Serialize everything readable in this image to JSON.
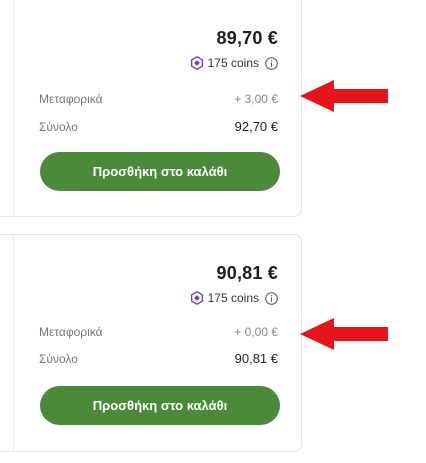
{
  "offers": [
    {
      "price": "89,70 €",
      "coins_text": "175 coins",
      "shipping_label": "Μεταφορικά",
      "shipping_value": "+ 3,00 €",
      "total_label": "Σύνολο",
      "total_value": "92,70 €",
      "button_label": "Προσθήκη στο καλάθι"
    },
    {
      "price": "90,81 €",
      "coins_text": "175 coins",
      "shipping_label": "Μεταφορικά",
      "shipping_value": "+ 0,00 €",
      "total_label": "Σύνολο",
      "total_value": "90,81 €",
      "button_label": "Προσθήκη στο καλάθι"
    }
  ],
  "icons": {
    "coin": "coin-icon",
    "info": "info-icon",
    "arrow": "red-arrow-annotation"
  },
  "colors": {
    "button_green": "#4a8a3a",
    "coin_purple": "#7b3fb8",
    "arrow_red": "#e4151b"
  }
}
